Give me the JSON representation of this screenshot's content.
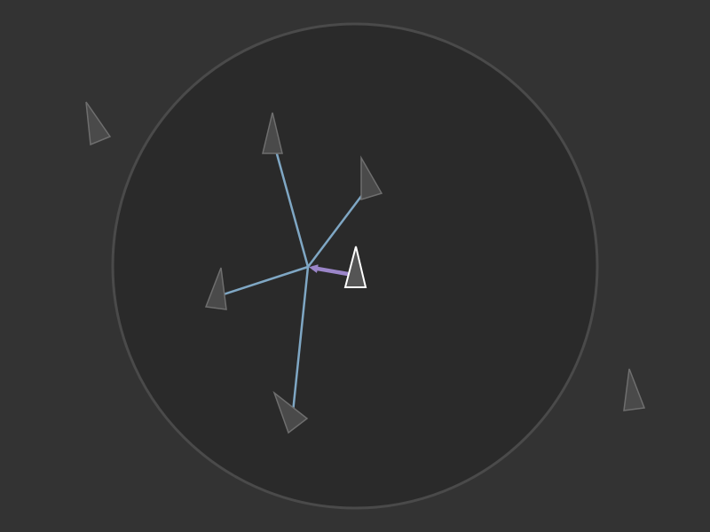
{
  "colors": {
    "background": "#333333",
    "perception_fill": "#2a2a2a",
    "perception_stroke": "#4a4a4a",
    "neighbor_link": "#7fa7c4",
    "steering_arrow": "#9b86c9",
    "focus_boid_fill": "#555555",
    "focus_boid_stroke": "#ffffff",
    "boid_fill": "#4a4a4a",
    "boid_stroke": "#6e6e6e"
  }
}
